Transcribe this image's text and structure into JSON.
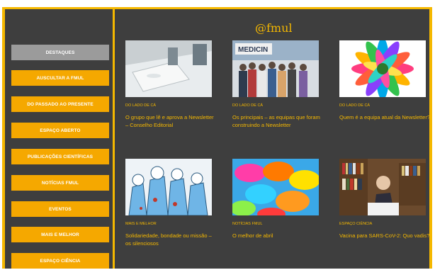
{
  "brand": {
    "name": "@fmul"
  },
  "sidebar": {
    "items": [
      {
        "label": "Destaques",
        "active": true
      },
      {
        "label": "Auscultar a FMUL"
      },
      {
        "label": "Do Passado ao Presente"
      },
      {
        "label": "Espaço Aberto"
      },
      {
        "label": "Publicações Científicas"
      },
      {
        "label": "Notícias FMUL"
      },
      {
        "label": "Eventos"
      },
      {
        "label": "Mais e Melhor"
      },
      {
        "label": "Espaço Ciência"
      }
    ]
  },
  "articles": [
    {
      "category": "Do lado de cá",
      "title": "O grupo que lê e aprova a Newsletter – Conselho Editorial",
      "image": "meeting-table-photo"
    },
    {
      "category": "Do lado de cá",
      "title": "Os principais – as equipas que foram construindo a Newsletter",
      "image": "group-photo-medicina"
    },
    {
      "category": "Do lado de cá",
      "title": "Quem é a equipa atual da Newsletter?",
      "image": "colorful-flower-photo"
    },
    {
      "category": "Mais e Melhor",
      "title": "Solidariedade, bondade ou missão – os silenciosos",
      "image": "health-workers-illustration"
    },
    {
      "category": "Notícias FMUL",
      "title": "O melhor de abril",
      "image": "colorful-umbrellas-photo"
    },
    {
      "category": "Espaço Ciência",
      "title": "Vacina para SARS-CoV-2: Quo vadis?",
      "image": "man-in-library-photo"
    }
  ],
  "colors": {
    "accent": "#f5b800",
    "background": "#3e3e3e",
    "button": "#f5a800",
    "button_active": "#9b9b9b"
  }
}
